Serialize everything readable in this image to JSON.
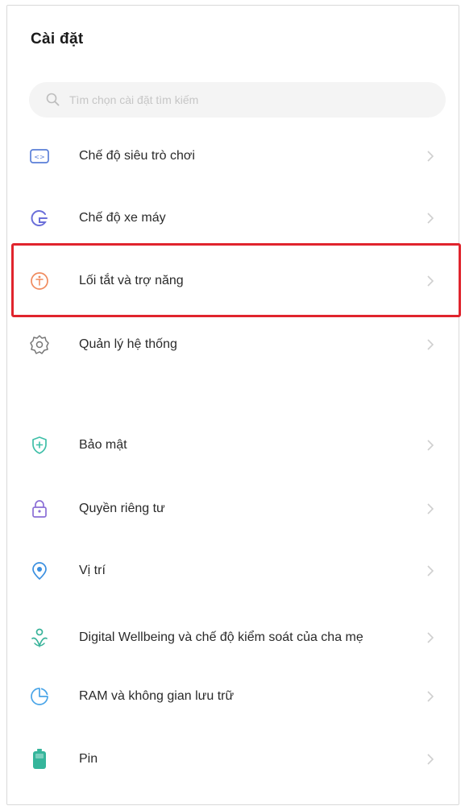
{
  "header": {
    "title": "Cài đặt"
  },
  "search": {
    "icon": "search-icon",
    "placeholder": "Tìm chọn cài đặt tìm kiếm"
  },
  "items_group_1": [
    {
      "label": "Chế độ siêu trò chơi",
      "icon": "game-mode-icon"
    },
    {
      "label": "Chế độ xe máy",
      "icon": "motorbike-mode-icon"
    },
    {
      "label": "Lối tắt và trợ năng",
      "icon": "accessibility-icon",
      "highlighted": true
    },
    {
      "label": "Quản lý hệ thống",
      "icon": "gear-icon"
    }
  ],
  "items_group_2": [
    {
      "label": "Bảo mật",
      "icon": "shield-icon"
    },
    {
      "label": "Quyền riêng tư",
      "icon": "privacy-lock-icon"
    },
    {
      "label": "Vị trí",
      "icon": "location-icon"
    },
    {
      "label": "Digital Wellbeing và chế độ kiểm soát của cha mẹ",
      "icon": "wellbeing-icon"
    },
    {
      "label": "RAM và không gian lưu trữ",
      "icon": "storage-icon"
    },
    {
      "label": "Pin",
      "icon": "battery-icon"
    }
  ],
  "colors": {
    "highlight_border": "#e0242d",
    "chevron": "#c8c8c8"
  }
}
